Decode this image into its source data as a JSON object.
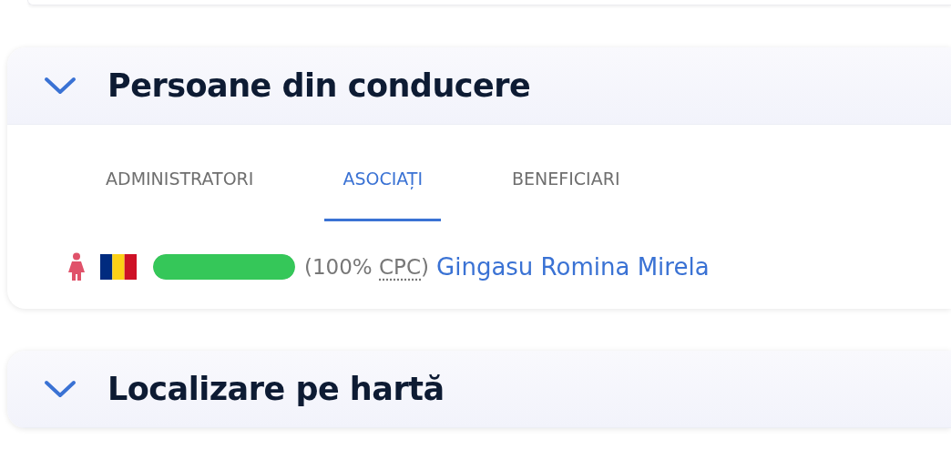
{
  "sections": [
    {
      "title": "Persoane din conducere",
      "expanded": true,
      "tabs": [
        {
          "label": "ADMINISTRATORI",
          "selected": false
        },
        {
          "label": "ASOCIAȚI",
          "selected": true
        },
        {
          "label": "BENEFICIARI",
          "selected": false
        }
      ],
      "persons": [
        {
          "level": 1,
          "share_prefix": "(100% ",
          "share_abbr": "CPC",
          "share_suffix": ")",
          "name": "Gingasu Romina Mirela"
        }
      ]
    },
    {
      "title": "Localizare pe hartă",
      "expanded": true
    }
  ]
}
